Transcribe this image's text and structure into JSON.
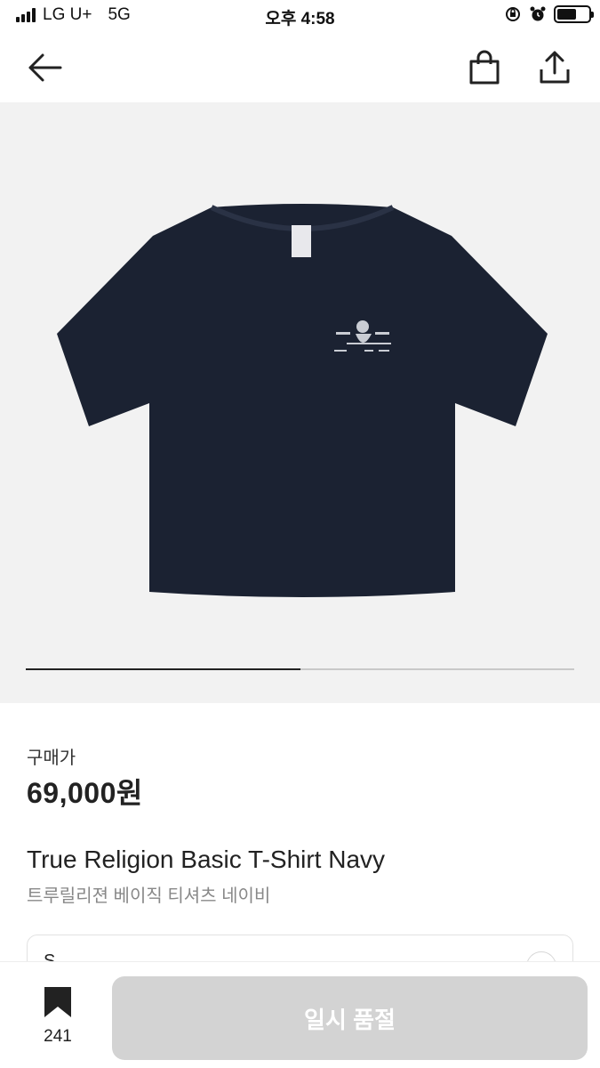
{
  "status_bar": {
    "carrier": "LG U+",
    "network": "5G",
    "time": "오후 4:58"
  },
  "nav": {
    "back_icon": "arrow-left-icon",
    "cart_icon": "shopping-bag-icon",
    "share_icon": "share-icon"
  },
  "product": {
    "image_progress": 0.5,
    "price_label": "구매가",
    "price": "69,000원",
    "name_en": "True Religion Basic T-Shirt Navy",
    "name_ko": "트루릴리젼 베이직 티셔츠 네이비",
    "size_box_text": "S",
    "shirt_color": "#1b2232"
  },
  "bottom_bar": {
    "bookmark_count": "241",
    "button_label": "일시 품절"
  },
  "colors": {
    "image_background": "#f2f2f2",
    "disabled_button": "#d3d3d3"
  }
}
